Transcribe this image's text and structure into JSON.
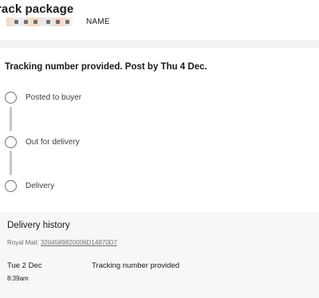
{
  "header": {
    "title": "rack package",
    "item_name": "NAME"
  },
  "status": {
    "heading": "Tracking number provided. Post by Thu 4 Dec."
  },
  "steps": [
    {
      "label": "Posted to buyer"
    },
    {
      "label": "Out for delivery"
    },
    {
      "label": "Delivery"
    }
  ],
  "history": {
    "title": "Delivery history",
    "carrier_prefix": "Royal Mail:",
    "tracking_number": "3204589820006D14870D7",
    "events": [
      {
        "date": "Tue 2 Dec",
        "time": "8:39am",
        "description": "Tracking number provided"
      }
    ]
  },
  "colors": {
    "background": "#ffffff",
    "history_background": "#f7f7f7",
    "circle_border": "#6e6e6e",
    "connector": "#c7c7c7"
  }
}
